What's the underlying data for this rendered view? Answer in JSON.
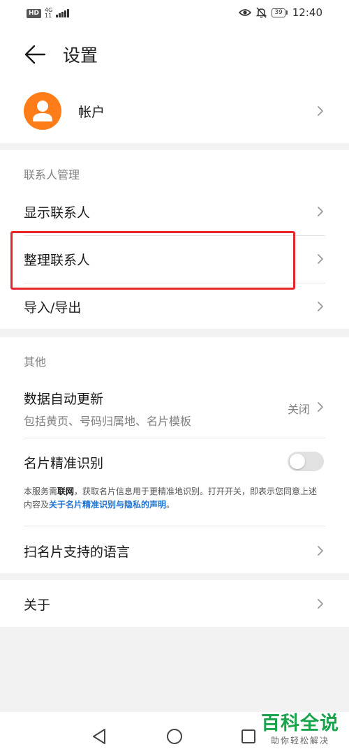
{
  "status_bar": {
    "hd": "HD",
    "network": "4G",
    "network_sub": "11",
    "battery": "39",
    "time": "12:40"
  },
  "header": {
    "title": "设置"
  },
  "account": {
    "label": "帐户"
  },
  "contacts_section": {
    "title": "联系人管理",
    "items": [
      {
        "label": "显示联系人"
      },
      {
        "label": "整理联系人"
      },
      {
        "label": "导入/导出"
      }
    ]
  },
  "other_section": {
    "title": "其他",
    "auto_update": {
      "label": "数据自动更新",
      "sub": "包括黄页、号码归属地、名片模板",
      "value": "关闭"
    },
    "card_recognition": {
      "label": "名片精准识别",
      "enabled": false,
      "desc_1": "本服务需",
      "desc_bold": "联网",
      "desc_2": "，获取名片信息用于更精准地识别。打开开关，即表示您同意上述内容及",
      "desc_link": "关于名片精准识别与隐私的声明",
      "desc_3": "。"
    },
    "languages": {
      "label": "扫名片支持的语言"
    }
  },
  "about": {
    "label": "关于"
  },
  "watermark": {
    "main": "百科全说",
    "sub": "助你轻松解决"
  },
  "colors": {
    "accent_avatar": "#ff7d19",
    "highlight": "#e5242b",
    "link": "#1e73d2",
    "watermark": "#19a34a"
  }
}
